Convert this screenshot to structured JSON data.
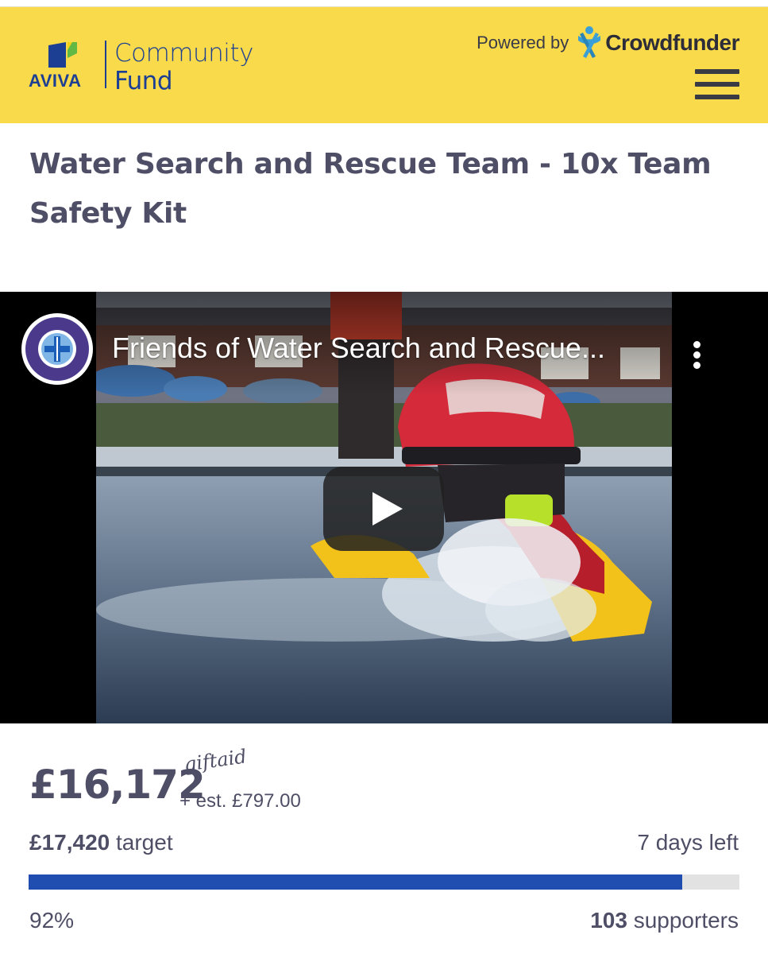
{
  "header": {
    "logo_word": "AVIVA",
    "logo_line1": "Community",
    "logo_line2": "Fund",
    "powered_by": "Powered by",
    "brand": "Crowdfunder",
    "menu_icon": "hamburger-menu-icon",
    "colors": {
      "background": "#f8da4a",
      "aviva_blue": "#1c3f94"
    }
  },
  "project": {
    "title": "Water Search and Rescue Team - 10x Team Safety Kit"
  },
  "video": {
    "title": "Friends of Water Search and Rescue...",
    "channel_avatar": "water-search-rescue-logo",
    "more_icon": "more-vert-icon",
    "play_icon": "play-icon"
  },
  "funding": {
    "raised": "£16,172",
    "giftaid_label": "giftaid",
    "giftaid_estimate": "+ est. £797.00",
    "target_amount": "£17,420",
    "target_label": "target",
    "days_left": "7 days left",
    "percent": "92%",
    "progress_fraction": 0.92,
    "supporters_count": "103",
    "supporters_label": "supporters",
    "colors": {
      "progress": "#1f4db0",
      "track": "#e2e2e2"
    }
  }
}
